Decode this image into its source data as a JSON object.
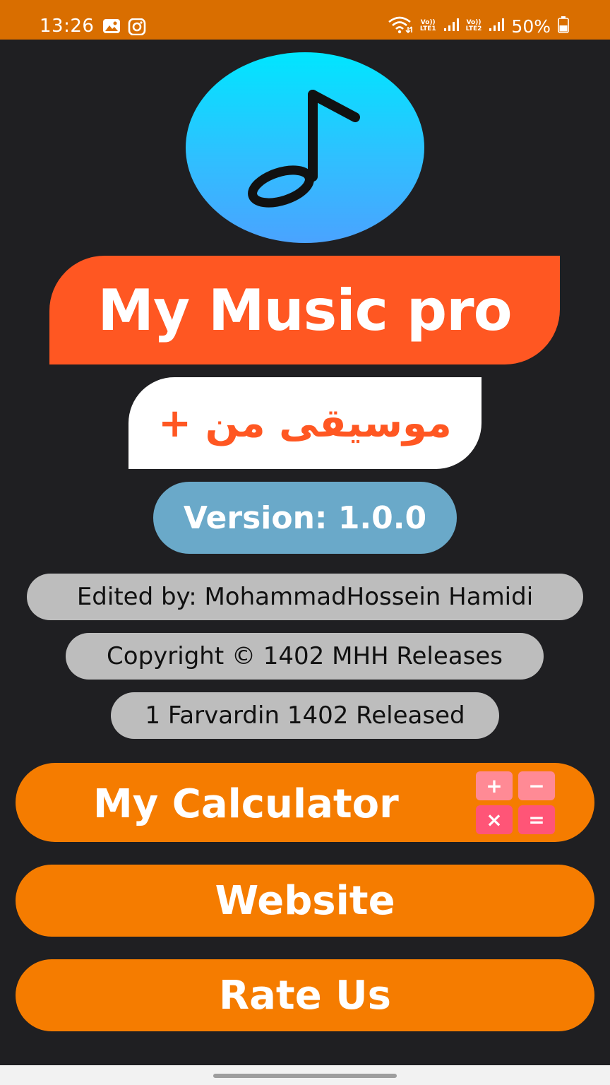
{
  "status_bar": {
    "time": "13:26",
    "sim1_label_top": "Vo))",
    "sim1_label_bottom": "LTE1",
    "sim2_label_top": "Vo))",
    "sim2_label_bottom": "LTE2",
    "battery_percent": "50%",
    "icons": [
      "gallery-icon",
      "instagram-icon",
      "wifi-icon",
      "signal-icon",
      "battery-icon"
    ]
  },
  "app": {
    "logo_icon": "music-note-icon",
    "title": "My Music pro",
    "subtitle": "موسیقی من +",
    "version": "Version: 1.0.0",
    "editor": "Edited by: MohammadHossein Hamidi",
    "copyright": "Copyright © 1402 MHH Releases",
    "release": "1 Farvardin 1402 Released"
  },
  "buttons": {
    "calculator": "My Calculator",
    "website": "Website",
    "rate": "Rate Us"
  },
  "calculator_icon": {
    "keys": [
      "+",
      "−",
      "×",
      "="
    ]
  },
  "colors": {
    "status_bar": "#d96e00",
    "background": "#1f1f22",
    "title_banner": "#ff5722",
    "version_pill": "#6aa9c9",
    "info_pill": "#bdbdbd",
    "button": "#f57c00",
    "calc_key_top": "#ff8a95",
    "calc_key_bottom": "#ff5577"
  }
}
